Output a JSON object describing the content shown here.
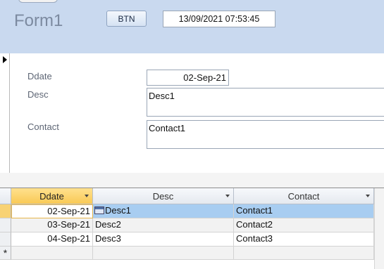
{
  "form": {
    "title": "Form1",
    "button_label": "BTN",
    "datetime": "13/09/2021 07:53:45"
  },
  "detail": {
    "labels": {
      "ddate": "Ddate",
      "desc": "Desc",
      "contact": "Contact"
    },
    "values": {
      "ddate": "02-Sep-21",
      "desc": "Desc1",
      "contact": "Contact1"
    }
  },
  "datasheet": {
    "columns": [
      "Ddate",
      "Desc",
      "Contact"
    ],
    "rows": [
      {
        "ddate": "02-Sep-21",
        "desc": "Desc1",
        "contact": "Contact1"
      },
      {
        "ddate": "03-Sep-21",
        "desc": "Desc2",
        "contact": "Contact2"
      },
      {
        "ddate": "04-Sep-21",
        "desc": "Desc3",
        "contact": "Contact3"
      }
    ],
    "new_record_marker": "*"
  },
  "colors": {
    "header_band": "#c9d9ef",
    "selected_row": "#a8cdf1",
    "active_column_header": "#f9c955"
  }
}
